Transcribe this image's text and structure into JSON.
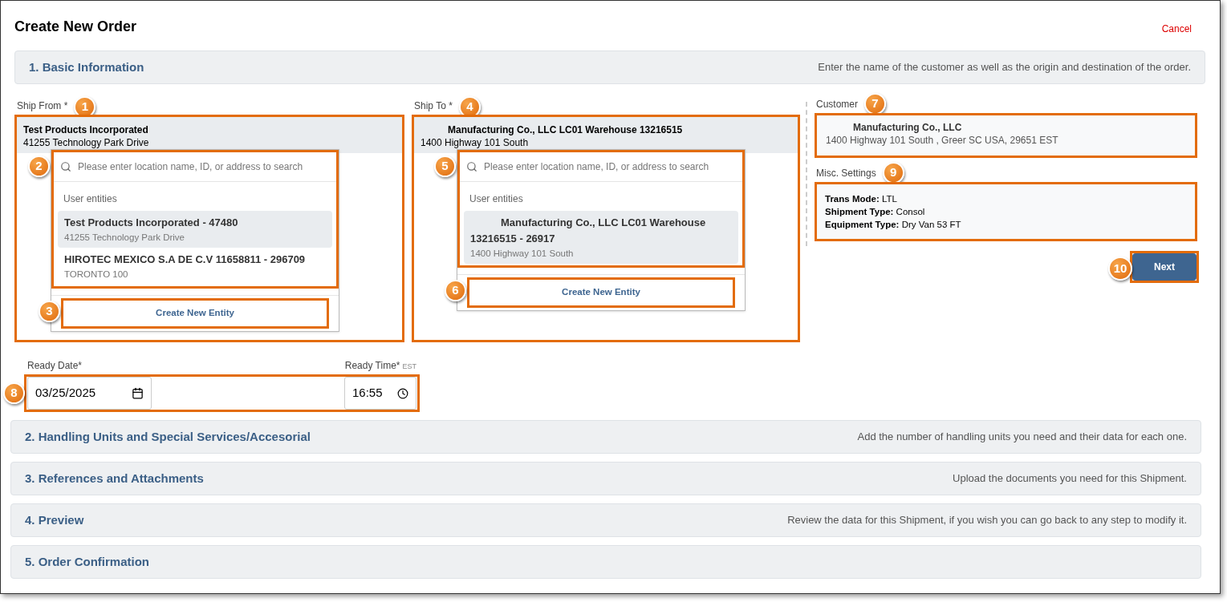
{
  "page": {
    "title": "Create New Order",
    "cancel": "Cancel"
  },
  "sections": [
    {
      "title": "1. Basic Information",
      "hint": "Enter the name of the customer as well as the origin and destination of the order."
    },
    {
      "title": "2. Handling Units and Special Services/Accesorial",
      "hint": "Add the number of handling units you need and their data for each one."
    },
    {
      "title": "3. References and Attachments",
      "hint": "Upload the documents you need for this Shipment."
    },
    {
      "title": "4. Preview",
      "hint": "Review the data for this Shipment, if you wish you can go back to any step to modify it."
    },
    {
      "title": "5. Order Confirmation"
    }
  ],
  "ship_from": {
    "label": "Ship From *",
    "callout": "1",
    "selected_name": "Test Products Incorporated",
    "selected_address": "41255 Technology Park Drive",
    "search": {
      "placeholder": "Please enter location name, ID, or address to search",
      "callout": "2"
    },
    "group": "User entities",
    "options": [
      {
        "name": "Test Products Incorporated - 47480",
        "address": "41255 Technology Park Drive",
        "selected": true
      },
      {
        "name": "HIROTEC MEXICO S.A DE C.V 11658811 - 296709",
        "address": "TORONTO 100",
        "selected": false
      }
    ],
    "create_button": {
      "label": "Create New Entity",
      "callout": "3"
    }
  },
  "ship_to": {
    "label": "Ship To *",
    "callout": "4",
    "selected_name": "Manufacturing Co., LLC LC01 Warehouse 13216515",
    "selected_address": "1400 Highway 101 South",
    "search": {
      "placeholder": "Please enter location name, ID, or address to search",
      "callout": "5"
    },
    "group": "User entities",
    "options": [
      {
        "name": "Manufacturing Co., LLC LC01 Warehouse 13216515 - 26917",
        "address": "1400 Highway 101 South",
        "selected": true
      }
    ],
    "create_button": {
      "label": "Create New Entity",
      "callout": "6"
    }
  },
  "customer": {
    "label": "Customer",
    "callout": "7",
    "name": "Manufacturing Co., LLC",
    "address": "1400 Highway 101 South , Greer SC USA, 29651 EST"
  },
  "misc": {
    "label": "Misc. Settings",
    "callout": "9",
    "lines": [
      "**Trans Mode:** LTL",
      "**Shipment Type:** Consol",
      "**Equipment Type:** Dry Van 53 FT"
    ]
  },
  "next_button": {
    "label": "Next",
    "callout": "10"
  },
  "ready": {
    "callout": "8",
    "date_label": "Ready Date*",
    "date_value": "03/25/2025",
    "time_label": "Ready Time*",
    "time_zone": "EST",
    "time_value": "16:55"
  }
}
